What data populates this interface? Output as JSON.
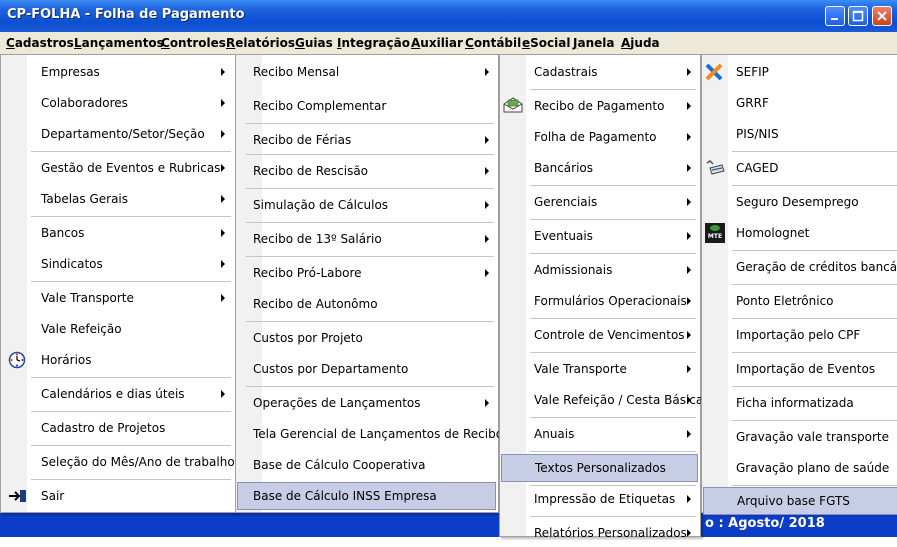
{
  "window": {
    "title": "CP-FOLHA - Folha de Pagamento"
  },
  "menubar": [
    "Cadastros",
    "Lançamentos",
    "Controles",
    "Relatórios",
    "Guias",
    "Integração",
    "Auxiliar",
    "Contábil",
    "eSocial",
    "Janela",
    "Ajuda"
  ],
  "status": {
    "text": "o : Agosto/ 2018"
  },
  "menu1": {
    "items": [
      "Empresas",
      "Colaboradores",
      "Departamento/Setor/Seção",
      "Gestão de Eventos e Rubricas",
      "Tabelas Gerais",
      "Bancos",
      "Sindicatos",
      "Vale Transporte",
      "Vale Refeição",
      "Horários",
      "Calendários e dias úteis",
      "Cadastro de Projetos",
      "Seleção do Mês/Ano de trabalho",
      "Sair"
    ]
  },
  "menu2": {
    "items": [
      "Recibo Mensal",
      "Recibo Complementar",
      "Recibo de Férias",
      "Recibo de Rescisão",
      "Simulação de Cálculos",
      "Recibo de 13º Salário",
      "Recibo Pró-Labore",
      "Recibo de Autonômo",
      "Custos por Projeto",
      "Custos por Departamento",
      "Operações de Lançamentos",
      "Tela Gerencial de Lançamentos de Recibos",
      "Base de Cálculo Cooperativa",
      "Base de Cálculo INSS Empresa"
    ]
  },
  "menu3": {
    "items": [
      "Cadastrais",
      "Recibo de Pagamento",
      "Folha de Pagamento",
      "Bancários",
      "Gerenciais",
      "Eventuais",
      "Admissionais",
      "Formulários Operacionais",
      "Controle de Vencimentos",
      "Vale Transporte",
      "Vale Refeição / Cesta Básica",
      "Anuais",
      "Textos Personalizados",
      "Impressão de Etiquetas",
      "Relatórios Personalizados"
    ]
  },
  "menu4": {
    "items": [
      "SEFIP",
      "GRRF",
      "PIS/NIS",
      "CAGED",
      "Seguro Desemprego",
      "Homolognet",
      "Geração de créditos bancários",
      "Ponto Eletrônico",
      "Importação pelo CPF",
      "Importação de Eventos",
      "Ficha informatizada",
      "Gravação vale transporte",
      "Gravação plano de saúde",
      "Arquivo base FGTS"
    ],
    "mte_icon_label": "MTE"
  },
  "colors": {
    "selection": "#c8cde6",
    "titlebar": "#0c4fd0",
    "menubar": "#ece9d8"
  }
}
